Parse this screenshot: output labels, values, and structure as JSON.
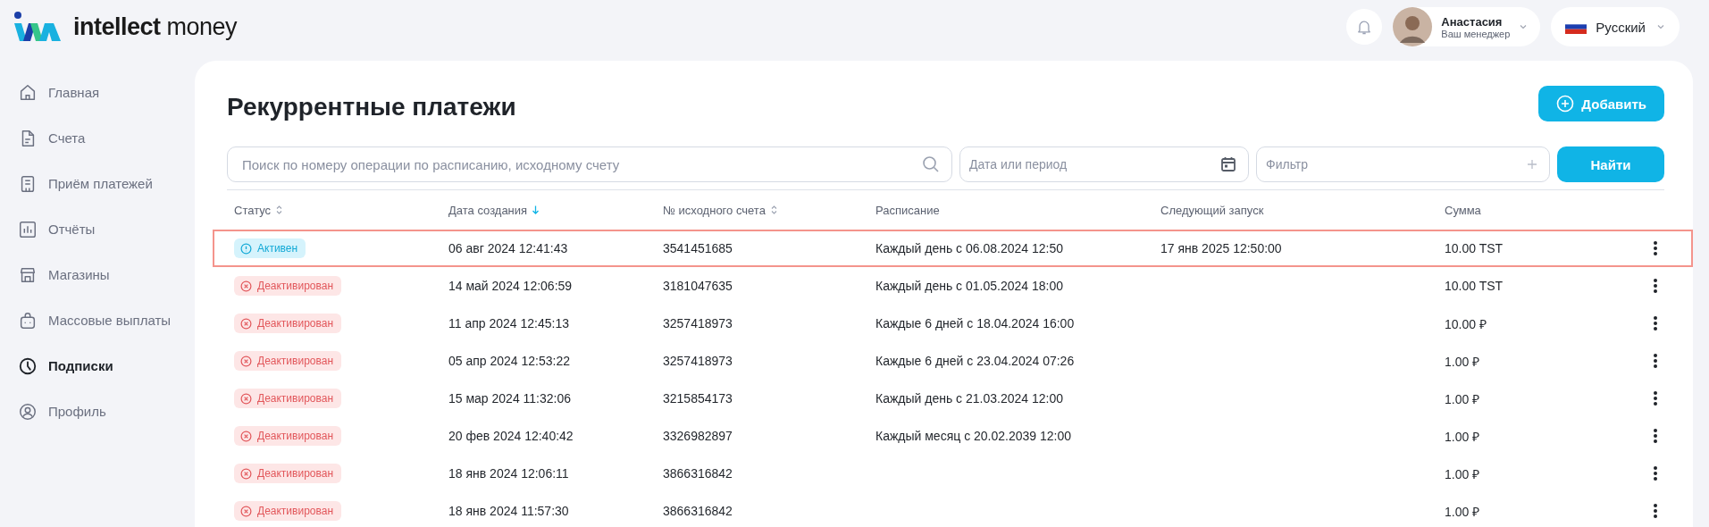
{
  "logo": {
    "text": "**intellect** money"
  },
  "header": {
    "user": {
      "name": "Анастасия",
      "role": "Ваш менеджер"
    },
    "language": "Русский"
  },
  "sidebar": {
    "items": [
      {
        "label": "Главная",
        "selected": false
      },
      {
        "label": "Счета",
        "selected": false
      },
      {
        "label": "Приём платежей",
        "selected": false
      },
      {
        "label": "Отчёты",
        "selected": false
      },
      {
        "label": "Магазины",
        "selected": false
      },
      {
        "label": "Массовые выплаты",
        "selected": false
      },
      {
        "label": "Подписки",
        "selected": true
      },
      {
        "label": "Профиль",
        "selected": false
      }
    ]
  },
  "page": {
    "title": "Рекуррентные платежи",
    "add_button": "Добавить",
    "search": {
      "placeholder": "Поиск по номеру операции по расписанию, исходному счету"
    },
    "date_field": {
      "placeholder": "Дата или период"
    },
    "filter_field": {
      "placeholder": "Фильтр"
    },
    "find_button": "Найти"
  },
  "table": {
    "columns": [
      {
        "label": "Статус",
        "sortable": true,
        "sorted_desc": false
      },
      {
        "label": "Дата создания",
        "sortable": true,
        "sorted_desc": true
      },
      {
        "label": "№ исходного счета",
        "sortable": true,
        "sorted_desc": false
      },
      {
        "label": "Расписание",
        "sortable": false
      },
      {
        "label": "Следующий запуск",
        "sortable": false
      },
      {
        "label": "Сумма",
        "sortable": false
      }
    ],
    "rows": [
      {
        "status": "Активен",
        "kind": "active",
        "created": "06 авг 2024 12:41:43",
        "account": "3541451685",
        "schedule": "Каждый день с 06.08.2024 12:50",
        "next_run": "17 янв 2025 12:50:00",
        "amount": "10.00 TST",
        "selected": true
      },
      {
        "status": "Деактивирован",
        "kind": "deactivated",
        "created": "14 май 2024 12:06:59",
        "account": "3181047635",
        "schedule": "Каждый день с 01.05.2024 18:00",
        "amount": "10.00 TST",
        "selected": false
      },
      {
        "status": "Деактивирован",
        "kind": "deactivated",
        "created": "11 апр 2024 12:45:13",
        "account": "3257418973",
        "schedule": "Каждые 6 дней с 18.04.2024 16:00",
        "amount": "10.00 ₽",
        "selected": false
      },
      {
        "status": "Деактивирован",
        "kind": "deactivated",
        "created": "05 апр 2024 12:53:22",
        "account": "3257418973",
        "schedule": "Каждые 6 дней с 23.04.2024 07:26",
        "amount": "1.00 ₽",
        "selected": false
      },
      {
        "status": "Деактивирован",
        "kind": "deactivated",
        "created": "15 мар 2024 11:32:06",
        "account": "3215854173",
        "schedule": "Каждый день с 21.03.2024 12:00",
        "amount": "1.00 ₽",
        "selected": false
      },
      {
        "status": "Деактивирован",
        "kind": "deactivated",
        "created": "20 фев 2024 12:40:42",
        "account": "3326982897",
        "schedule": "Каждый месяц с 20.02.2039 12:00",
        "amount": "1.00 ₽",
        "selected": false
      },
      {
        "status": "Деактивирован",
        "kind": "deactivated",
        "created": "18 янв 2024 12:06:11",
        "account": "3866316842",
        "amount": "1.00 ₽",
        "selected": false
      },
      {
        "status": "Деактивирован",
        "kind": "deactivated",
        "created": "18 янв 2024 11:57:30",
        "account": "3866316842",
        "amount": "1.00 ₽",
        "selected": false
      }
    ]
  }
}
